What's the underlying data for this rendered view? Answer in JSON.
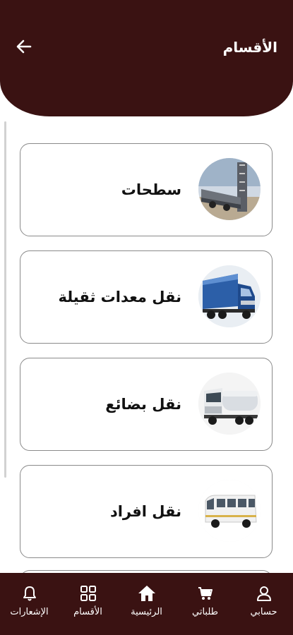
{
  "header": {
    "title": "الأقسام",
    "back_icon": "arrow-left-icon",
    "background": "#3a1212"
  },
  "categories": [
    {
      "label": "سطحات",
      "image": "flatbed-trailer-photo"
    },
    {
      "label": "نقل معدات ثقيلة",
      "image": "blue-semi-truck-photo"
    },
    {
      "label": "نقل بضائع",
      "image": "tanker-truck-photo"
    },
    {
      "label": "نقل افراد",
      "image": "minibus-photo"
    }
  ],
  "bottom_nav": {
    "items": [
      {
        "label": "حسابي",
        "icon": "user-icon"
      },
      {
        "label": "طلباتي",
        "icon": "cart-icon"
      },
      {
        "label": "الرئيسية",
        "icon": "home-icon"
      },
      {
        "label": "الأقسام",
        "icon": "grid-icon"
      },
      {
        "label": "الإشعارات",
        "icon": "bell-icon"
      }
    ],
    "active": "الرئيسية"
  },
  "colors": {
    "brand": "#3a1212",
    "card_border": "#8a8a8a"
  }
}
